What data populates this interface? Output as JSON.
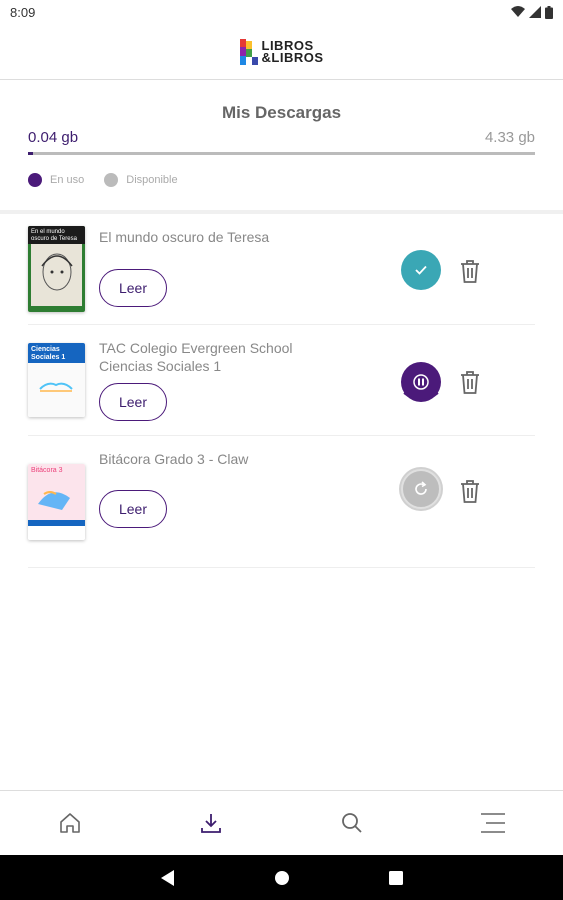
{
  "status_bar": {
    "time": "8:09"
  },
  "header": {
    "logo_line1": "LIBROS",
    "logo_line2": "&LIBROS"
  },
  "storage": {
    "title": "Mis Descargas",
    "used": "0.04 gb",
    "total": "4.33 gb",
    "used_fraction": 0.01,
    "legend_used": "En uso",
    "legend_available": "Disponible",
    "used_color": "#4b1a7a",
    "available_color": "#bbbbbb"
  },
  "downloads": [
    {
      "title": "El mundo oscuro de Teresa",
      "read_label": "Leer",
      "status": "completed",
      "status_icon": "check-icon"
    },
    {
      "title": "TAC Colegio Evergreen School Ciencias Sociales 1",
      "read_label": "Leer",
      "status": "downloading",
      "status_icon": "pause-icon"
    },
    {
      "title": "Bitácora Grado 3 - Claw",
      "read_label": "Leer",
      "status": "pending",
      "status_icon": "retry-icon"
    }
  ],
  "covers": [
    {
      "cover_text": "En el mundo oscuro de Teresa"
    },
    {
      "cover_text": "Ciencias Sociales 1"
    },
    {
      "cover_text": "Bitácora 3"
    }
  ],
  "bottom_nav": [
    "home-icon",
    "download-icon",
    "search-icon",
    "menu-icon"
  ],
  "accent_color": "#3d1d6e",
  "teal_color": "#3aa7b5"
}
